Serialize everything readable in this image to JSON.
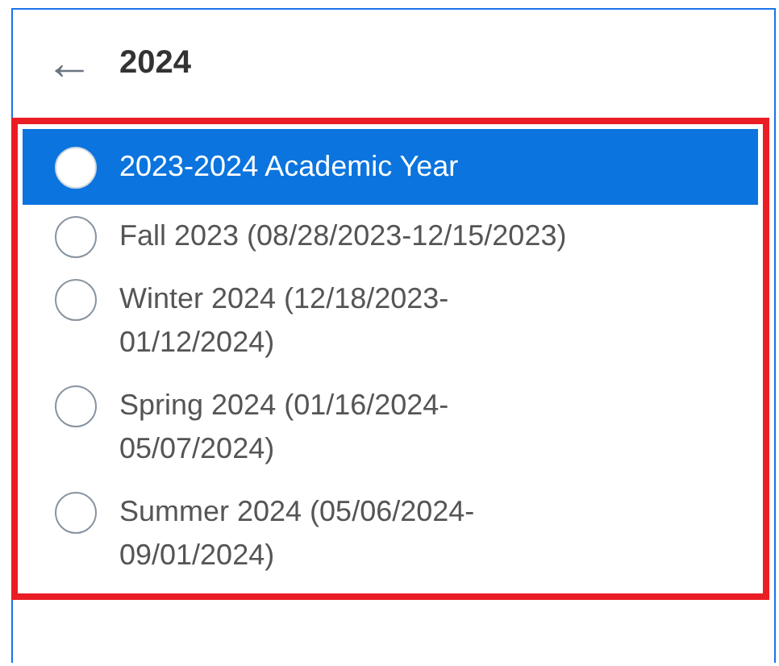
{
  "header": {
    "back": "←",
    "title": "2024"
  },
  "options": [
    {
      "label": "2023-2024 Academic Year",
      "selected": true
    },
    {
      "label": "Fall 2023 (08/28/2023-12/15/2023)",
      "selected": false
    },
    {
      "label": "Winter 2024 (12/18/2023-01/12/2024)",
      "selected": false
    },
    {
      "label": "Spring 2024 (01/16/2024-05/07/2024)",
      "selected": false
    },
    {
      "label": "Summer 2024 (05/06/2024-09/01/2024)",
      "selected": false
    }
  ]
}
